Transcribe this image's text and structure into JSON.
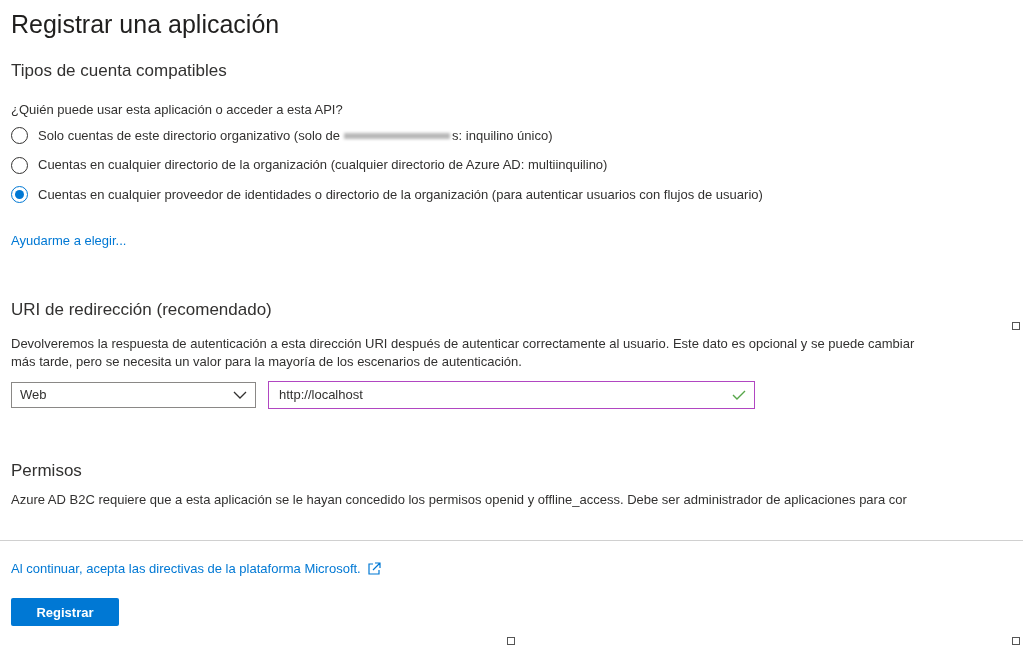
{
  "title": "Registrar una aplicación",
  "account_types": {
    "heading": "Tipos de cuenta compatibles",
    "question": "¿Quién puede usar esta aplicación o acceder a esta API?",
    "options": [
      {
        "label_parts": [
          "Solo cuentas de este directorio organizativo (solo de",
          "s: inquilino único)"
        ],
        "selected": false
      },
      {
        "label_parts": [
          "Cuentas en cualquier directorio de la organización (cualquier directorio de Azure AD: multiinquilino)"
        ],
        "selected": false
      },
      {
        "label_parts": [
          "Cuentas en cualquier proveedor de identidades o directorio de la organización (para autenticar usuarios con flujos de usuario)"
        ],
        "selected": true
      }
    ],
    "help_link": "Ayudarme a elegir..."
  },
  "redirect": {
    "heading": "URI de redirección (recomendado)",
    "description": "Devolveremos la respuesta de autenticación a esta dirección URI después de autenticar correctamente al usuario. Este dato es opcional y se puede cambiar más tarde, pero se necesita un valor para la mayoría de los escenarios de autenticación.",
    "platform": "Web",
    "uri": "http://localhost",
    "valid": true
  },
  "permissions": {
    "heading": "Permisos",
    "text": "Azure AD B2C requiere que a esta aplicación se le hayan concedido los permisos openid y offline_access. Debe ser administrador de aplicaciones para cor"
  },
  "policy_link": "Al continuar, acepta las directivas de la plataforma Microsoft.",
  "submit": "Registrar"
}
